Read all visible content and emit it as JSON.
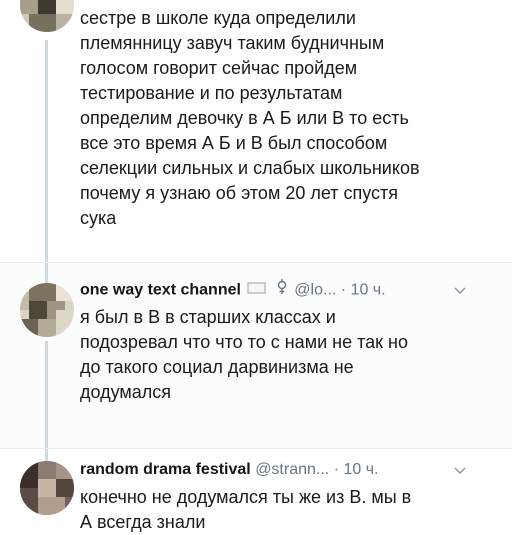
{
  "tweets": [
    {
      "text": "сестре в школе куда определили\nплемянницу завуч таким будничным\nголосом говорит сейчас пройдем\nтестирование и по результатам\nопределим девочку в А Б или В то есть\nвсе это время А Б и В был способом\nселекции сильных и слабых школьников\nпочему я узнаю об этом 20 лет спустя\nсука"
    },
    {
      "name": "one way text channel",
      "handle": "@lo...",
      "dot": "·",
      "time": "10 ч.",
      "text": "я был в В в старших классах и\nподозревал что что то с нами не так но\nдо такого социал дарвинизма не\nдодумался",
      "icons": [
        "flag-icon",
        "gender-symbol-icon",
        "chevron-down-icon"
      ]
    },
    {
      "name": "random drama festival",
      "handle": "@strann...",
      "dot": "·",
      "time": "10 ч.",
      "text": "конечно не додумался ты же из В. мы в\nА всегда знали",
      "icons": [
        "chevron-down-icon"
      ]
    }
  ],
  "colors": {
    "text": "#1a1a1a",
    "secondary": "#657786",
    "thread_line": "#cfd9de",
    "divider": "#e6ecf0"
  }
}
